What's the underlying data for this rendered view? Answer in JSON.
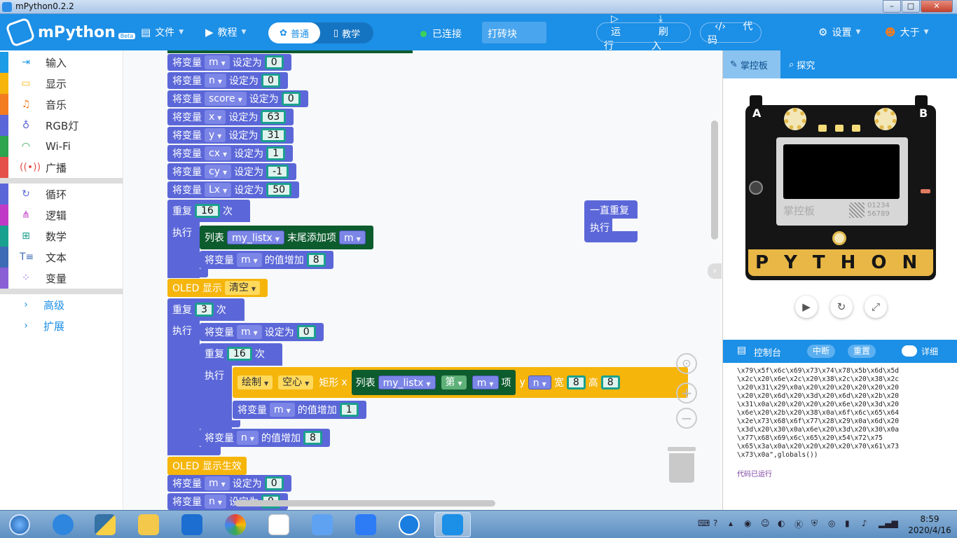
{
  "window": {
    "title": "mPython0.2.2",
    "min": "–",
    "max": "□",
    "close": "✕"
  },
  "header": {
    "app_name": "mPython",
    "beta": "Beta",
    "file": "文件",
    "tutorial": "教程",
    "mode_normal": "普通",
    "mode_teach": "教学",
    "connection": "已连接",
    "filename": "打砖块",
    "run": "运行",
    "flash": "刷入",
    "code": "代码",
    "settings": "设置",
    "user": "大于"
  },
  "sidebar": {
    "items": [
      {
        "label": "输入",
        "icon": "input-icon",
        "color": "#1c9be6"
      },
      {
        "label": "显示",
        "icon": "display-icon",
        "color": "#f5b50b"
      },
      {
        "label": "音乐",
        "icon": "music-icon",
        "color": "#f47c20"
      },
      {
        "label": "RGB灯",
        "icon": "bulb-icon",
        "color": "#5b67d8"
      },
      {
        "label": "Wi-Fi",
        "icon": "wifi-icon",
        "color": "#2da44e"
      },
      {
        "label": "广播",
        "icon": "broadcast-icon",
        "color": "#e5504b"
      },
      {
        "label": "循环",
        "icon": "loop-icon",
        "color": "#5b67d8"
      },
      {
        "label": "逻辑",
        "icon": "logic-icon",
        "color": "#c13ac7"
      },
      {
        "label": "数学",
        "icon": "math-icon",
        "color": "#1aa08e"
      },
      {
        "label": "文本",
        "icon": "text-icon",
        "color": "#3d6bb5"
      },
      {
        "label": "变量",
        "icon": "variable-icon",
        "color": "#8a5fd6"
      }
    ],
    "advanced": "高级",
    "extensions": "扩展"
  },
  "blocks": {
    "set_var": "将变量",
    "set_to": "设定为",
    "repeat": "重复",
    "times": "次",
    "do": "执行",
    "list": "列表",
    "list_append": "末尾添加项",
    "increase": "的值增加",
    "oled_show": "OLED 显示",
    "clear": "清空",
    "oled_refresh": "OLED 显示生效",
    "draw": "绘制",
    "hollow": "空心",
    "rect": "矩形",
    "x": "x",
    "y": "y",
    "width": "宽",
    "height": "高",
    "nth": "第",
    "item": "项",
    "forever": "一直重复",
    "vars": [
      {
        "name": "m",
        "value": "0"
      },
      {
        "name": "n",
        "value": "0"
      },
      {
        "name": "score",
        "value": "0"
      },
      {
        "name": "x",
        "value": "63"
      },
      {
        "name": "y",
        "value": "31"
      },
      {
        "name": "cx",
        "value": "1"
      },
      {
        "name": "cy",
        "value": "-1"
      },
      {
        "name": "Lx",
        "value": "50"
      }
    ],
    "repeat1": "16",
    "list_name": "my_listx",
    "inc8": "8",
    "repeat2": "3",
    "m0": "0",
    "repeat3": "16",
    "w": "8",
    "h": "8",
    "inc1": "1"
  },
  "right": {
    "tab_board": "掌控板",
    "tab_explore": "探究",
    "board_brand": "掌控板",
    "board_serial": "01234\n56789",
    "board_letters": "PYTHON",
    "btn_a": "A",
    "btn_b": "B",
    "console_title": "控制台",
    "interrupt": "中断",
    "reset": "重置",
    "detail": "详细",
    "console_text": "\\x79\\x5f\\x6c\\x69\\x73\\x74\\x78\\x5b\\x6d\\x5d\n\\x2c\\x20\\x6e\\x2c\\x20\\x38\\x2c\\x20\\x38\\x2c\n\\x20\\x31\\x29\\x0a\\x20\\x20\\x20\\x20\\x20\\x20\n\\x20\\x20\\x6d\\x20\\x3d\\x20\\x6d\\x20\\x2b\\x20\n\\x31\\x0a\\x20\\x20\\x20\\x20\\x6e\\x20\\x3d\\x20\n\\x6e\\x20\\x2b\\x20\\x38\\x0a\\x6f\\x6c\\x65\\x64\n\\x2e\\x73\\x68\\x6f\\x77\\x28\\x29\\x0a\\x6d\\x20\n\\x3d\\x20\\x30\\x0a\\x6e\\x20\\x3d\\x20\\x30\\x0a\n\\x77\\x68\\x69\\x6c\\x65\\x20\\x54\\x72\\x75\n\\x65\\x3a\\x0a\\x20\\x20\\x20\\x20\\x70\\x61\\x73\n\\x73\\x0a\",globals())",
    "console_status": "代码已运行"
  },
  "taskbar": {
    "time": "8:59",
    "date": "2020/4/16"
  }
}
